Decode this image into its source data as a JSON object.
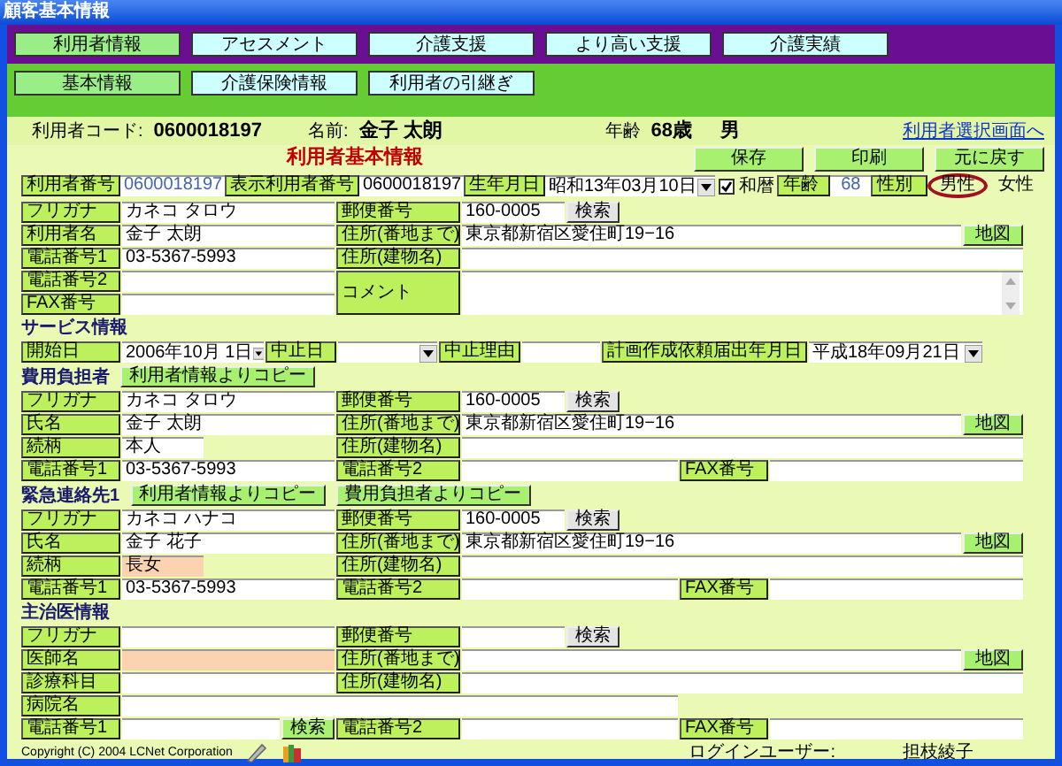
{
  "window": {
    "title": "顧客基本情報"
  },
  "main_tabs": [
    {
      "label": "利用者情報",
      "selected": true
    },
    {
      "label": "アセスメント",
      "selected": false
    },
    {
      "label": "介護支援",
      "selected": false
    },
    {
      "label": "より高い支援",
      "selected": false
    },
    {
      "label": "介護実績",
      "selected": false
    }
  ],
  "sub_tabs": [
    {
      "label": "基本情報",
      "selected": true
    },
    {
      "label": "介護保険情報",
      "selected": false
    },
    {
      "label": "利用者の引継ぎ",
      "selected": false
    }
  ],
  "user_header": {
    "code_label": "利用者コード:",
    "code": "0600018197",
    "name_label": "名前:",
    "name": "金子  太朗",
    "age_label": "年齢",
    "age": "68歳",
    "sex": "男",
    "link": "利用者選択画面へ"
  },
  "basic_info": {
    "title": "利用者基本情報",
    "buttons": [
      "保存",
      "印刷",
      "元に戻す"
    ],
    "user_number": {
      "label": "利用者番号",
      "value": "0600018197"
    },
    "display_number": {
      "label": "表示利用者番号",
      "value": "0600018197"
    },
    "birth_date": {
      "label": "生年月日",
      "value": "昭和13年03月10日"
    },
    "wareki": {
      "label": "和暦",
      "checked": true
    },
    "age": {
      "label": "年齢",
      "value": "68"
    },
    "sex": {
      "label": "性別",
      "options": [
        {
          "label": "男性",
          "selected": true
        },
        {
          "label": "女性",
          "selected": false
        }
      ]
    },
    "furigana": {
      "label": "フリガナ",
      "value": "カネコ タロウ"
    },
    "postal": {
      "label": "郵便番号",
      "value": "160-0005",
      "button": "検索"
    },
    "name": {
      "label": "利用者名",
      "value": "金子  太朗"
    },
    "address": {
      "label": "住所(番地まで)",
      "value": "東京都新宿区愛住町19−16",
      "button": "地図"
    },
    "phone1": {
      "label": "電話番号1",
      "value": "03-5367-5993"
    },
    "building": {
      "label": "住所(建物名)"
    },
    "phone2": {
      "label": "電話番号2"
    },
    "comment": {
      "label": "コメント"
    },
    "fax": {
      "label": "FAX番号"
    }
  },
  "service": {
    "title": "サービス情報",
    "start": {
      "label": "開始日",
      "value": "2006年10月 1日"
    },
    "stop": {
      "label": "中止日"
    },
    "stop_reason": {
      "label": "中止理由"
    },
    "plan_date": {
      "label": "計画作成依頼届出年月日",
      "value": "平成18年09月21日"
    }
  },
  "contacts": [
    {
      "title": "費用負担者",
      "buttons": [
        "利用者情報よりコピー"
      ],
      "furigana": {
        "label": "フリガナ",
        "value": "カネコ タロウ"
      },
      "name": {
        "label": "氏名",
        "value": "金子  太朗"
      },
      "relation": {
        "label": "続柄",
        "value": "本人",
        "highlighted": false
      },
      "phone1": {
        "label": "電話番号1",
        "value": "03-5367-5993"
      },
      "postal": {
        "label": "郵便番号",
        "value": "160-0005",
        "button": "検索"
      },
      "address": {
        "label": "住所(番地まで)",
        "value": "東京都新宿区愛住町19−16",
        "button": "地図"
      },
      "building": {
        "label": "住所(建物名)"
      },
      "phone2": {
        "label": "電話番号2"
      },
      "fax": {
        "label": "FAX番号"
      }
    },
    {
      "title": "緊急連絡先1",
      "buttons": [
        "利用者情報よりコピー",
        "費用負担者よりコピー"
      ],
      "furigana": {
        "label": "フリガナ",
        "value": "カネコ ハナコ"
      },
      "name": {
        "label": "氏名",
        "value": "金子  花子"
      },
      "relation": {
        "label": "続柄",
        "value": "長女",
        "highlighted": true
      },
      "phone1": {
        "label": "電話番号1",
        "value": "03-5367-5993"
      },
      "postal": {
        "label": "郵便番号",
        "value": "160-0005",
        "button": "検索"
      },
      "address": {
        "label": "住所(番地まで)",
        "value": "東京都新宿区愛住町19−16",
        "button": "地図"
      },
      "building": {
        "label": "住所(建物名)"
      },
      "phone2": {
        "label": "電話番号2"
      },
      "fax": {
        "label": "FAX番号"
      }
    }
  ],
  "doctor": {
    "title": "主治医情報",
    "furigana": {
      "label": "フリガナ"
    },
    "doctor_name": {
      "label": "医師名",
      "highlighted": true
    },
    "department": {
      "label": "診療科目"
    },
    "hospital": {
      "label": "病院名"
    },
    "phone1": {
      "label": "電話番号1",
      "button": "検索"
    },
    "postal": {
      "label": "郵便番号",
      "button": "検索"
    },
    "address": {
      "label": "住所(番地まで)",
      "button": "地図"
    },
    "building": {
      "label": "住所(建物名)"
    },
    "phone2": {
      "label": "電話番号2"
    },
    "fax": {
      "label": "FAX番号"
    }
  },
  "footer": {
    "copyright": "Copyright (C) 2004 LCNet Corporation",
    "login_label": "ログインユーザー:",
    "login_user": "担枝綾子"
  }
}
